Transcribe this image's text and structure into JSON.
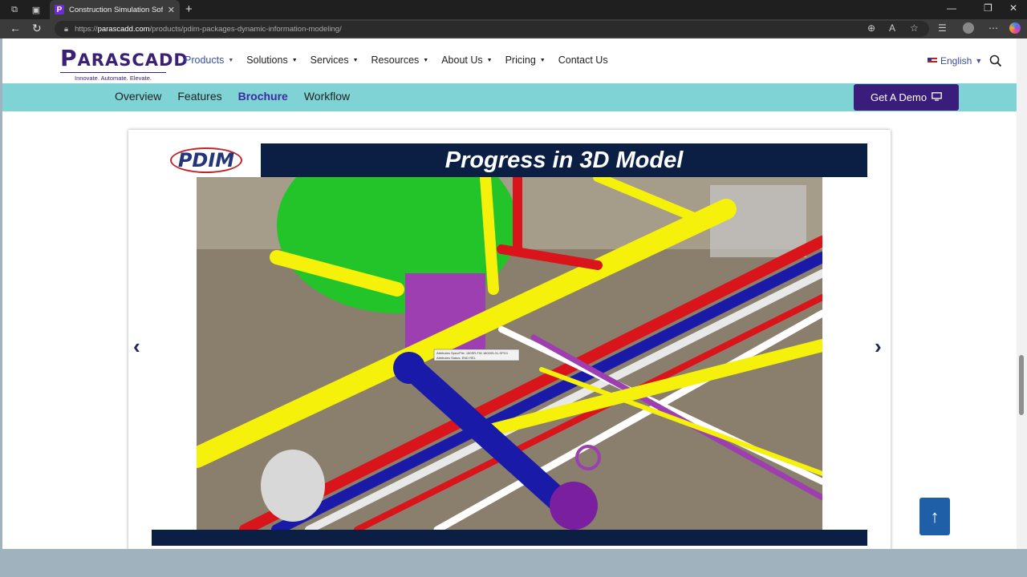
{
  "browser": {
    "tab_title": "Construction Simulation Software",
    "tab_favicon": "P",
    "url_host": "parascadd.com",
    "url_prefix": "https://",
    "url_path": "/products/pdim-packages-dynamic-information-modeling/"
  },
  "header": {
    "logo_first": "P",
    "logo_rest": "ARASCADD",
    "logo_tagline": "Innovate. Automate. Elevate.",
    "nav": [
      {
        "label": "Products"
      },
      {
        "label": "Solutions"
      },
      {
        "label": "Services"
      },
      {
        "label": "Resources"
      },
      {
        "label": "About Us"
      },
      {
        "label": "Pricing"
      },
      {
        "label": "Contact Us"
      }
    ],
    "language": "English"
  },
  "subnav": {
    "links": [
      "Overview",
      "Features",
      "Brochure",
      "Workflow"
    ],
    "demo_label": "Get A Demo"
  },
  "slide": {
    "logo_text": "PDIM",
    "title": "Progress in 3D Model",
    "tooltip_line1": "Attributes Spec/File: 180SR-FW-180005-01-SPG1",
    "tooltip_line2": "Attributes Status: END REL"
  },
  "colors": {
    "brand": "#3b2175",
    "subnav": "#7fd3d4",
    "slide_header": "#0b1f44",
    "demo_button": "#3a1c7a",
    "scroll_top": "#1e5fa8"
  }
}
